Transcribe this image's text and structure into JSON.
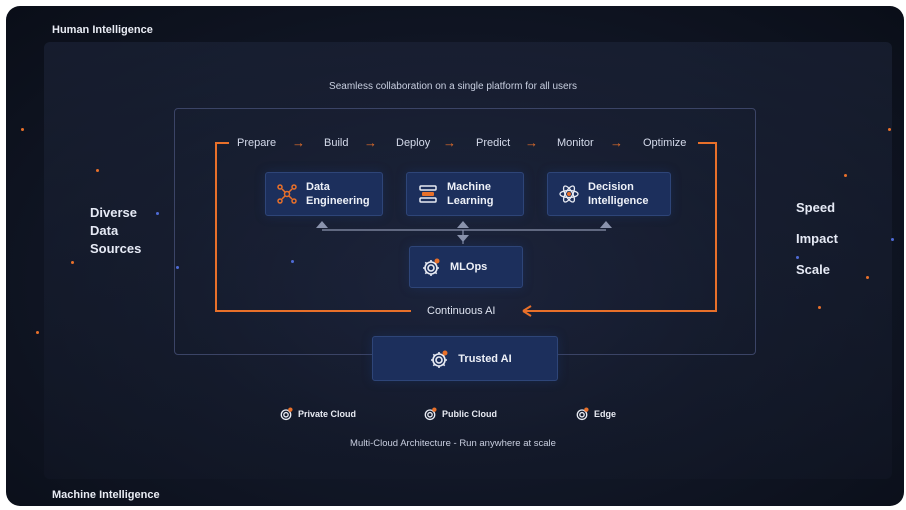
{
  "labels": {
    "top_left": "Human Intelligence",
    "bottom_left": "Machine Intelligence",
    "tagline": "Seamless collaboration on a single platform for all users",
    "footer": "Multi-Cloud Architecture - Run anywhere at scale",
    "loop": "Continuous AI"
  },
  "left_side": [
    "Diverse",
    "Data",
    "Sources"
  ],
  "right_side": [
    "Speed",
    "Impact",
    "Scale"
  ],
  "steps": [
    "Prepare",
    "Build",
    "Deploy",
    "Predict",
    "Monitor",
    "Optimize"
  ],
  "boxes": {
    "data_engineering": [
      "Data",
      "Engineering"
    ],
    "machine_learning": [
      "Machine",
      "Learning"
    ],
    "decision_intelligence": [
      "Decision",
      "Intelligence"
    ],
    "mlops": "MLOps",
    "trusted_ai": "Trusted AI"
  },
  "clouds": [
    "Private Cloud",
    "Public Cloud",
    "Edge"
  ],
  "colors": {
    "accent": "#e8702a",
    "box_fill": "#1c2f5c",
    "background": "#121828"
  }
}
